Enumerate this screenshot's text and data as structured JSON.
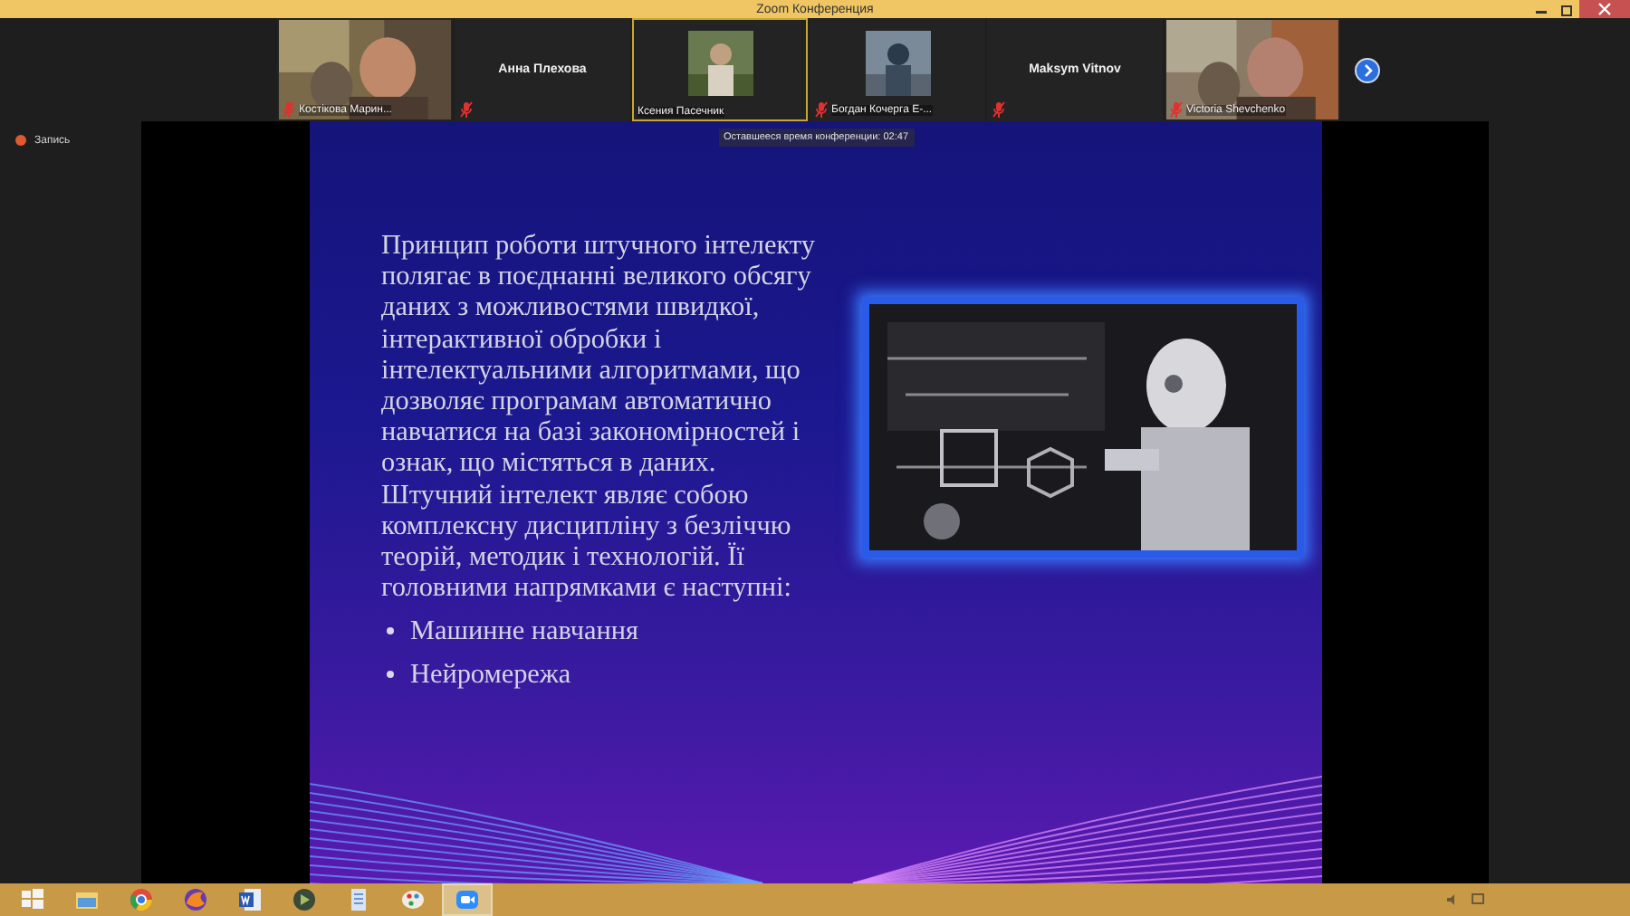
{
  "window": {
    "title": "Zoom Конференция"
  },
  "participants": [
    {
      "name": "Костікова Марин...",
      "kind": "video",
      "muted": true,
      "speaking": false
    },
    {
      "name": "Анна Плехова",
      "kind": "name",
      "muted": true,
      "speaking": false
    },
    {
      "name": "Ксения Пасечник",
      "muted": false,
      "speaking": true
    },
    {
      "name": "Богдан Кочерга Е-...",
      "muted": true,
      "speaking": false
    },
    {
      "name": "Maksym Vitnov",
      "kind": "name",
      "muted": true,
      "speaking": false
    },
    {
      "name": "Victoria Shevchenko",
      "kind": "video",
      "muted": true,
      "speaking": false
    }
  ],
  "recording": {
    "label": "Запись"
  },
  "timer": "Оставшееся время конференции: 02:47",
  "slide": {
    "paragraph": "Принцип роботи штучного інтелекту полягає в поєднанні великого обсягу даних з можливостями швидкої, інтерактивної обробки і інтелектуальними алгоритмами, що дозволяє програмам автоматично навчатися на базі закономірностей і ознак, що містяться в даних. Штучний інтелект являє собою комплексну дисципліну з безліччю теорій, методик і технологій. Її головними напрямками є наступні:",
    "bullets": [
      "Машинне навчання",
      "Нейромережа"
    ]
  },
  "taskbar": [
    {
      "kind": "start",
      "selected": false
    },
    {
      "kind": "folder",
      "selected": false
    },
    {
      "kind": "browser",
      "selected": false
    },
    {
      "kind": "fox",
      "selected": false
    },
    {
      "kind": "word",
      "selected": false
    },
    {
      "kind": "media",
      "selected": false
    },
    {
      "kind": "notepad",
      "selected": false
    },
    {
      "kind": "paint",
      "selected": false
    },
    {
      "kind": "zoom",
      "selected": true
    }
  ]
}
